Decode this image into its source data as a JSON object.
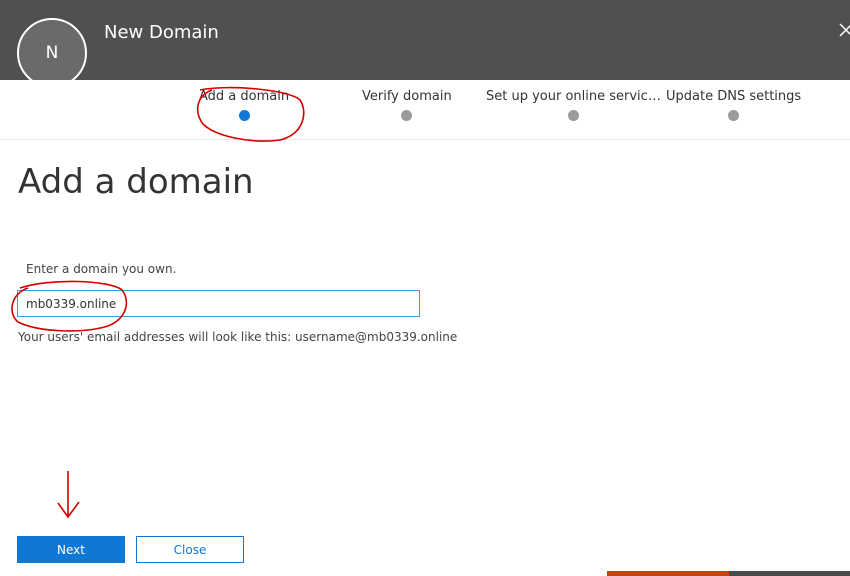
{
  "header": {
    "avatar_initial": "N",
    "title": "New Domain",
    "close_icon": "close-icon"
  },
  "steps": [
    {
      "label": "Add a domain",
      "active": true
    },
    {
      "label": "Verify domain",
      "active": false
    },
    {
      "label": "Set up your online servic…",
      "active": false
    },
    {
      "label": "Update DNS settings",
      "active": false
    }
  ],
  "main": {
    "title": "Add a domain",
    "field_label": "Enter a domain you own.",
    "domain_value": "mb0339.online",
    "hint": "Your users' email addresses will look like this: username@mb0339.online"
  },
  "buttons": {
    "next": "Next",
    "close": "Close"
  },
  "colors": {
    "accent": "#0f78d4",
    "header_bg": "#505050",
    "annotation": "#d40000",
    "bottom_bar": "#d83b01"
  }
}
